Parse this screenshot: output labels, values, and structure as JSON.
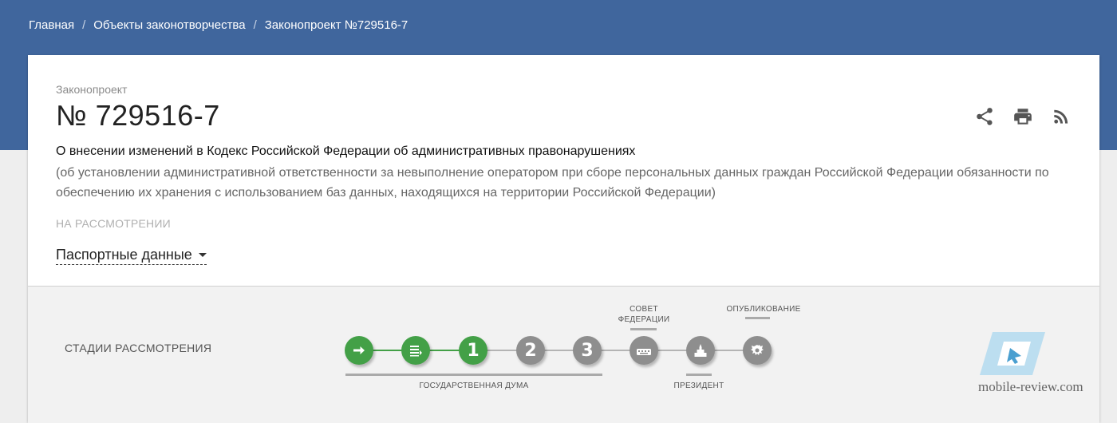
{
  "breadcrumb": {
    "home": "Главная",
    "section": "Объекты законотворчества",
    "current": "Законопроект №729516-7",
    "separator": "/"
  },
  "bill": {
    "type": "Законопроект",
    "number": "№ 729516-7",
    "title": "О внесении изменений в Кодекс Российской Федерации об административных правонарушениях",
    "subtitle": "(об установлении административной ответственности за невыполнение оператором при сборе персональных данных граждан Российской Федерации обязанности по обеспечению их хранения с использованием баз данных, находящихся на территории Российской Федерации)",
    "status": "НА РАССМОТРЕНИИ",
    "passport_label": "Паспортные данные"
  },
  "actions": {
    "share_icon": "share-icon",
    "print_icon": "print-icon",
    "rss_icon": "rss-icon"
  },
  "stages": {
    "label": "СТАДИИ РАССМОТРЕНИЯ",
    "nodes": [
      {
        "id": "introduced",
        "icon": "arrow-right-icon",
        "done": true
      },
      {
        "id": "preliminary",
        "icon": "document-list-icon",
        "done": true
      },
      {
        "id": "reading-1",
        "text": "1",
        "done": true
      },
      {
        "id": "reading-2",
        "text": "2",
        "done": false
      },
      {
        "id": "reading-3",
        "text": "3",
        "done": false
      },
      {
        "id": "federation-council",
        "icon": "council-icon",
        "done": false
      },
      {
        "id": "president",
        "icon": "kremlin-icon",
        "done": false
      },
      {
        "id": "published",
        "icon": "eagle-emblem-icon",
        "done": false
      }
    ],
    "labels": {
      "duma": "ГОСУДАРСТВЕННАЯ ДУМА",
      "council_line1": "СОВЕТ",
      "council_line2": "ФЕДЕРАЦИИ",
      "president": "ПРЕЗИДЕНТ",
      "published": "ОПУБЛИКОВАНИЕ"
    }
  },
  "watermark": {
    "text": "mobile-review.com",
    "logo_icon": "mobile-review-logo-icon"
  },
  "colors": {
    "header": "#40669d",
    "done": "#43a047",
    "pending": "#8e8e8e"
  }
}
